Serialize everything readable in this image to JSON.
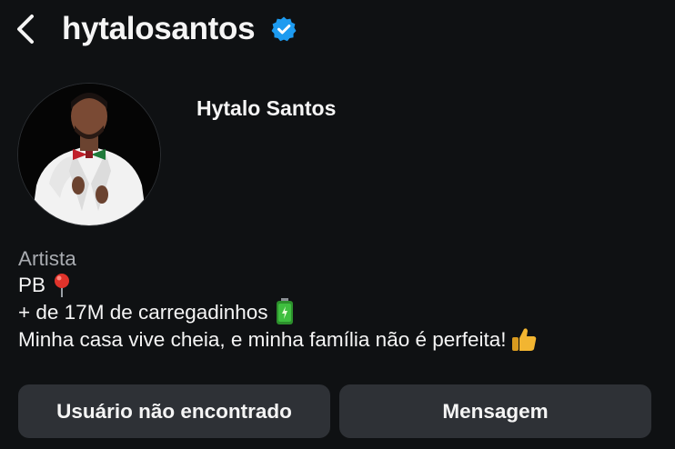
{
  "header": {
    "username": "hytalosantos",
    "verified": true
  },
  "profile": {
    "display_name": "Hytalo Santos"
  },
  "bio": {
    "category": "Artista",
    "location": "PB",
    "line_followers": "+ de 17M de carregadinhos",
    "tagline": "Minha casa vive cheia, e minha família não é perfeita!"
  },
  "actions": {
    "primary_label": "Usuário não encontrado",
    "message_label": "Mensagem"
  },
  "icons": {
    "back": "chevron-left-icon",
    "verified": "verified-badge-icon",
    "location": "round-pushpin-icon",
    "battery": "battery-icon",
    "thumbs_up": "thumbs-up-icon"
  },
  "colors": {
    "background": "#0f1113",
    "text": "#f5f5f5",
    "muted": "#a8abb0",
    "button": "#2e3136",
    "verified": "#1d9bf0",
    "pin": "#e0332b",
    "battery": "#3fbf3f",
    "thumb": "#f2b531"
  }
}
